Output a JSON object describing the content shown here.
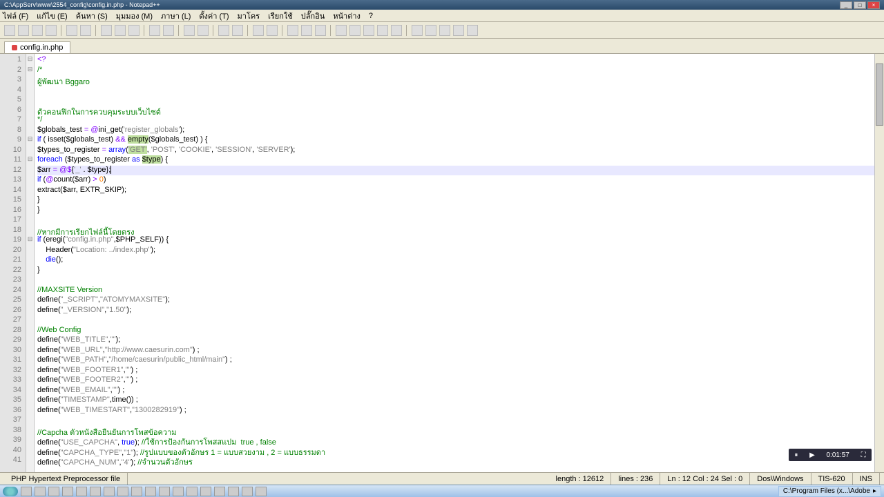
{
  "title": "C:\\AppServ\\www\\2554_config\\config.in.php - Notepad++",
  "menus": [
    "ไฟล์ (F)",
    "แก้ไข (E)",
    "ค้นหา (S)",
    "มุมมอง (M)",
    "ภาษา (L)",
    "ตั้งค่า (T)",
    "มาโคร",
    "เรียกใช้",
    "ปลั๊กอิน",
    "หน้าต่าง",
    "?"
  ],
  "tab": {
    "label": "config.in.php"
  },
  "lines": [
    {
      "n": 1,
      "fold": "⊟",
      "html": "<span class='op'>&lt;?</span>"
    },
    {
      "n": 2,
      "fold": "⊟",
      "html": "<span class='cmt'>/*</span>"
    },
    {
      "n": 3,
      "fold": "",
      "html": "<span class='cmt'>ผู้พัฒนา Bggaro</span>"
    },
    {
      "n": 4,
      "fold": "",
      "html": ""
    },
    {
      "n": 5,
      "fold": "",
      "html": ""
    },
    {
      "n": 6,
      "fold": "",
      "html": "<span class='cmt'>ตัวคอนฟิกในการควบคุมระบบเว็บไซต์</span>"
    },
    {
      "n": 7,
      "fold": "",
      "html": "<span class='cmt'>*/</span>"
    },
    {
      "n": 8,
      "fold": "",
      "html": "<span class='var'>$globals_test</span> <span class='op'>=</span> <span class='op'>@</span><span class='var'>ini_get</span>(<span class='str'>'register_globals'</span>);"
    },
    {
      "n": 9,
      "fold": "⊟",
      "html": "<span class='kw'>if</span> ( <span class='var'>isset</span>(<span class='var'>$globals_test</span>) <span class='op'>&amp;&amp;</span> <span class='hlw'>empty</span>(<span class='var'>$globals_test</span>) ) {"
    },
    {
      "n": 10,
      "fold": "",
      "html": "<span class='var'>$types_to_register</span> <span class='op'>=</span> <span class='kw'>array</span>(<span class='str hlw'>'GET'</span>, <span class='str'>'POST'</span>, <span class='str'>'COOKIE'</span>, <span class='str'>'SESSION'</span>, <span class='str'>'SERVER'</span>);"
    },
    {
      "n": 11,
      "fold": "⊟",
      "html": "<span class='kw'>foreach</span> (<span class='var'>$types_to_register</span> <span class='kw'>as</span> <span class='var hlw'>$type</span>) {"
    },
    {
      "n": 12,
      "fold": "",
      "cls": "hl-line",
      "html": "<span class='var'>$arr</span> <span class='op'>=</span> <span class='op'>@$</span>{<span class='str'>'_'</span> . <span class='var'>$type</span>}<span class='caret'>;</span>"
    },
    {
      "n": 13,
      "fold": "",
      "html": "<span class='kw'>if</span> (<span class='op'>@</span><span class='var'>count</span>(<span class='var'>$arr</span>) <span class='op'>&gt;</span> <span class='num'>0</span>)"
    },
    {
      "n": 14,
      "fold": "",
      "html": "<span class='var'>extract</span>(<span class='var'>$arr</span>, EXTR_SKIP);"
    },
    {
      "n": 15,
      "fold": "",
      "html": "}"
    },
    {
      "n": 16,
      "fold": "",
      "html": "}"
    },
    {
      "n": 17,
      "fold": "",
      "html": ""
    },
    {
      "n": 18,
      "fold": "",
      "html": "<span class='cmt'>//หากมีการเรียกไฟล์นี้โดยตรง</span>"
    },
    {
      "n": 19,
      "fold": "⊟",
      "html": "<span class='kw'>if</span> (<span class='var'>eregi</span>(<span class='str'>\"config.in.php\"</span>,<span class='var'>$PHP_SELF</span>)) {"
    },
    {
      "n": 20,
      "fold": "",
      "html": "    <span class='var'>Header</span>(<span class='str'>\"Location: ../index.php\"</span>);"
    },
    {
      "n": 21,
      "fold": "",
      "html": "    <span class='kw'>die</span>();"
    },
    {
      "n": 22,
      "fold": "",
      "html": "}"
    },
    {
      "n": 23,
      "fold": "",
      "html": ""
    },
    {
      "n": 24,
      "fold": "",
      "html": "<span class='cmt'>//MAXSITE Version</span>"
    },
    {
      "n": 25,
      "fold": "",
      "html": "<span class='var'>define</span>(<span class='str'>\"_SCRIPT\"</span>,<span class='str'>\"ATOMYMAXSITE\"</span>);"
    },
    {
      "n": 26,
      "fold": "",
      "html": "<span class='var'>define</span>(<span class='str'>\"_VERSION\"</span>,<span class='str'>\"1.50\"</span>);"
    },
    {
      "n": 27,
      "fold": "",
      "html": ""
    },
    {
      "n": 28,
      "fold": "",
      "html": "<span class='cmt'>//Web Config</span>"
    },
    {
      "n": 29,
      "fold": "",
      "html": "<span class='var'>define</span>(<span class='str'>\"WEB_TITLE\"</span>,<span class='str'>\"\"</span>);"
    },
    {
      "n": 30,
      "fold": "",
      "html": "<span class='var'>define</span>(<span class='str'>\"WEB_URL\"</span>,<span class='str'>\"http://www.caesurin.com\"</span>) ;"
    },
    {
      "n": 31,
      "fold": "",
      "html": "<span class='var'>define</span>(<span class='str'>\"WEB_PATH\"</span>,<span class='str'>\"/home/caesurin/public_html/main\"</span>) ;"
    },
    {
      "n": 32,
      "fold": "",
      "html": "<span class='var'>define</span>(<span class='str'>\"WEB_FOOTER1\"</span>,<span class='str'>\"\"</span>) ;"
    },
    {
      "n": 33,
      "fold": "",
      "html": "<span class='var'>define</span>(<span class='str'>\"WEB_FOOTER2\"</span>,<span class='str'>\"\"</span>) ;"
    },
    {
      "n": 34,
      "fold": "",
      "html": "<span class='var'>define</span>(<span class='str'>\"WEB_EMAIL\"</span>,<span class='str'>\"\"</span>) ;"
    },
    {
      "n": 35,
      "fold": "",
      "html": "<span class='var'>define</span>(<span class='str'>\"TIMESTAMP\"</span>,<span class='var'>time</span>()) ;"
    },
    {
      "n": 36,
      "fold": "",
      "html": "<span class='var'>define</span>(<span class='str'>\"WEB_TIMESTART\"</span>,<span class='str'>\"1300282919\"</span>) ;"
    },
    {
      "n": 37,
      "fold": "",
      "html": ""
    },
    {
      "n": 38,
      "fold": "",
      "html": "<span class='cmt'>//Capcha ตัวหนังสือยืนยันการโพสข้อความ</span>"
    },
    {
      "n": 39,
      "fold": "",
      "html": "<span class='var'>define</span>(<span class='str'>\"USE_CAPCHA\"</span>, <span class='kw'>true</span>); <span class='cmt'>//ใช้การป้องกันการโพสสแปม  true , false</span>"
    },
    {
      "n": 40,
      "fold": "",
      "html": "<span class='var'>define</span>(<span class='str'>\"CAPCHA_TYPE\"</span>,<span class='str'>\"1\"</span>); <span class='cmt'>//รูปแบบของตัวอักษร 1 = แบบสวยงาม , 2 = แบบธรรมดา</span>"
    },
    {
      "n": 41,
      "fold": "",
      "html": "<span class='var'>define</span>(<span class='str'>\"CAPCHA_NUM\"</span>,<span class='str'>\"4\"</span>); <span class='cmt'>//จำนวนตัวอักษร</span>"
    }
  ],
  "status": {
    "filetype": "PHP Hypertext Preprocessor file",
    "length": "length : 12612",
    "lines": "lines : 236",
    "pos": "Ln : 12    Col : 24    Sel : 0",
    "eol": "Dos\\Windows",
    "enc": "TIS-620",
    "ins": "INS"
  },
  "overlay": {
    "time": "0:01:57"
  },
  "tray": {
    "path": "C:\\Program Files (x...\\Adobe"
  }
}
